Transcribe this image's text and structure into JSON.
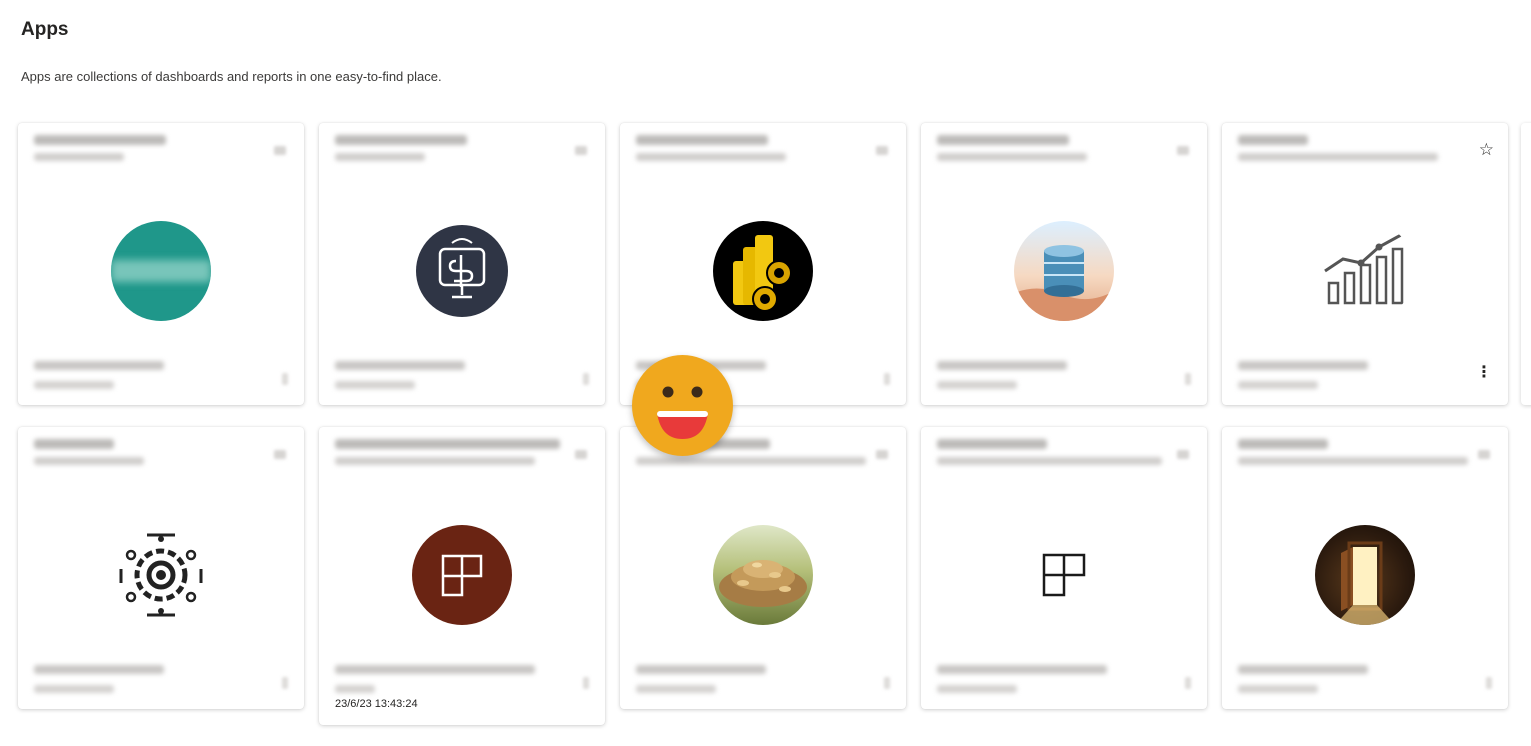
{
  "page": {
    "title": "Apps",
    "description": "Apps are collections of dashboards and reports in one easy-to-find place."
  },
  "icons": {
    "star": "☆",
    "more": "⋮"
  },
  "tooltip": {
    "timestamp": "23/6/23 13:43:24"
  },
  "colors": {
    "teal": "#1f978a",
    "navy": "#2f3545",
    "brown": "#6a2413",
    "emoji": "#f0a81e"
  },
  "cards": [
    {
      "thumb": "teal-logo-circle"
    },
    {
      "thumb": "monitor-dollar-icon"
    },
    {
      "thumb": "powerbi-gears-icon"
    },
    {
      "thumb": "database-desert-image"
    },
    {
      "thumb": "growth-chart-icon"
    },
    {
      "thumb": "gear-circuit-icon"
    },
    {
      "thumb": "app-tiles-icon"
    },
    {
      "thumb": "coins-pile-image"
    },
    {
      "thumb": "app-tiles-outline-icon"
    },
    {
      "thumb": "open-door-image"
    }
  ]
}
